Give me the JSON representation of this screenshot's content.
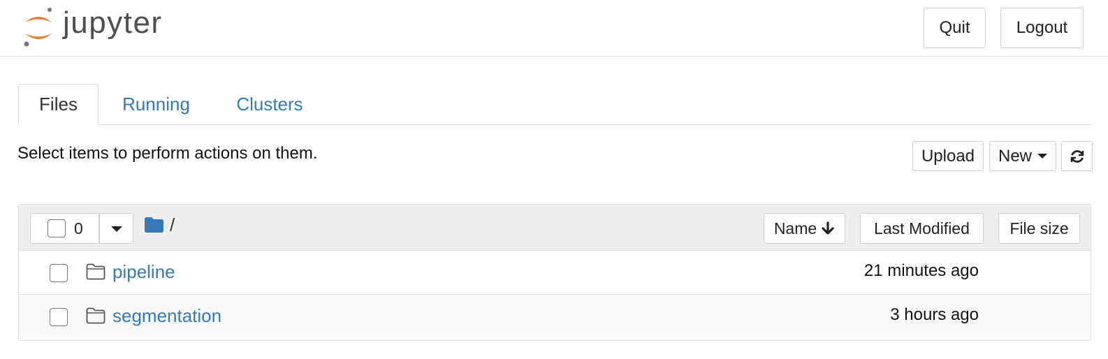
{
  "header": {
    "logo_text": "jupyter",
    "quit_label": "Quit",
    "logout_label": "Logout"
  },
  "tabs": [
    {
      "label": "Files",
      "active": true
    },
    {
      "label": "Running",
      "active": false
    },
    {
      "label": "Clusters",
      "active": false
    }
  ],
  "toolbar": {
    "instructions": "Select items to perform actions on them.",
    "upload_label": "Upload",
    "new_label": "New"
  },
  "list": {
    "selected_count": "0",
    "breadcrumb": "/",
    "columns": {
      "name": "Name",
      "last_modified": "Last Modified",
      "file_size": "File size"
    },
    "items": [
      {
        "name": "pipeline",
        "modified": "21 minutes ago",
        "type": "folder"
      },
      {
        "name": "segmentation",
        "modified": "3 hours ago",
        "type": "folder"
      }
    ]
  },
  "colors": {
    "link": "#337ab7",
    "logo_orange": "#f37726",
    "logo_gray": "#767677",
    "folder_blue": "#337ab7"
  },
  "icons": [
    "jupyter-logo",
    "caret-down-icon",
    "refresh-icon",
    "folder-icon",
    "arrow-down-icon"
  ]
}
